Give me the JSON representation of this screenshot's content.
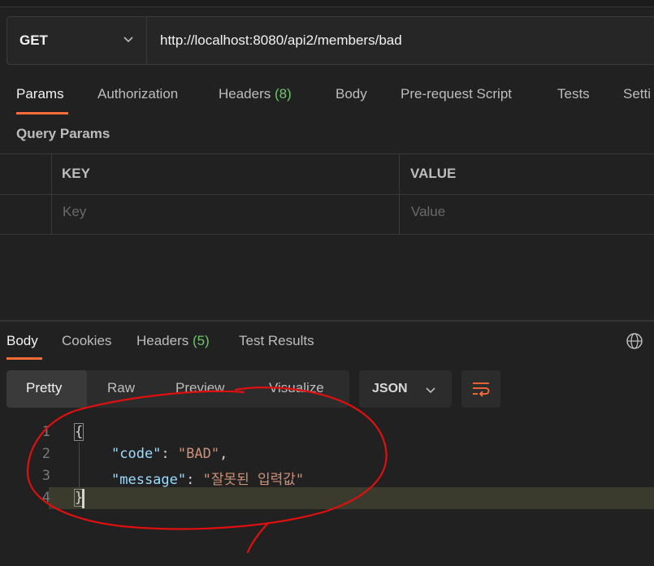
{
  "request": {
    "method": "GET",
    "url": "http://localhost:8080/api2/members/bad"
  },
  "request_tabs": {
    "params": "Params",
    "authorization": "Authorization",
    "headers": "Headers",
    "headers_count": "(8)",
    "body": "Body",
    "pre_request": "Pre-request Script",
    "tests": "Tests",
    "settings": "Setti"
  },
  "query_params": {
    "title": "Query Params",
    "columns": [
      "KEY",
      "VALUE"
    ],
    "placeholder": {
      "key": "Key",
      "value": "Value"
    }
  },
  "response_tabs": {
    "body": "Body",
    "cookies": "Cookies",
    "headers": "Headers",
    "headers_count": "(5)",
    "test_results": "Test Results"
  },
  "view_modes": [
    "Pretty",
    "Raw",
    "Preview",
    "Visualize"
  ],
  "format": "JSON",
  "response_body": {
    "line_numbers": [
      "1",
      "2",
      "3",
      "4"
    ],
    "open_brace": "{",
    "close_brace": "}",
    "lines": [
      {
        "key": "\"code\"",
        "value": "\"BAD\"",
        "trail": ","
      },
      {
        "key": "\"message\"",
        "value": "\"잘못된 입력값\"",
        "trail": ""
      }
    ]
  },
  "colors": {
    "accent": "#ff6c37",
    "count": "#6cc76c",
    "annotation": "#e01010"
  }
}
